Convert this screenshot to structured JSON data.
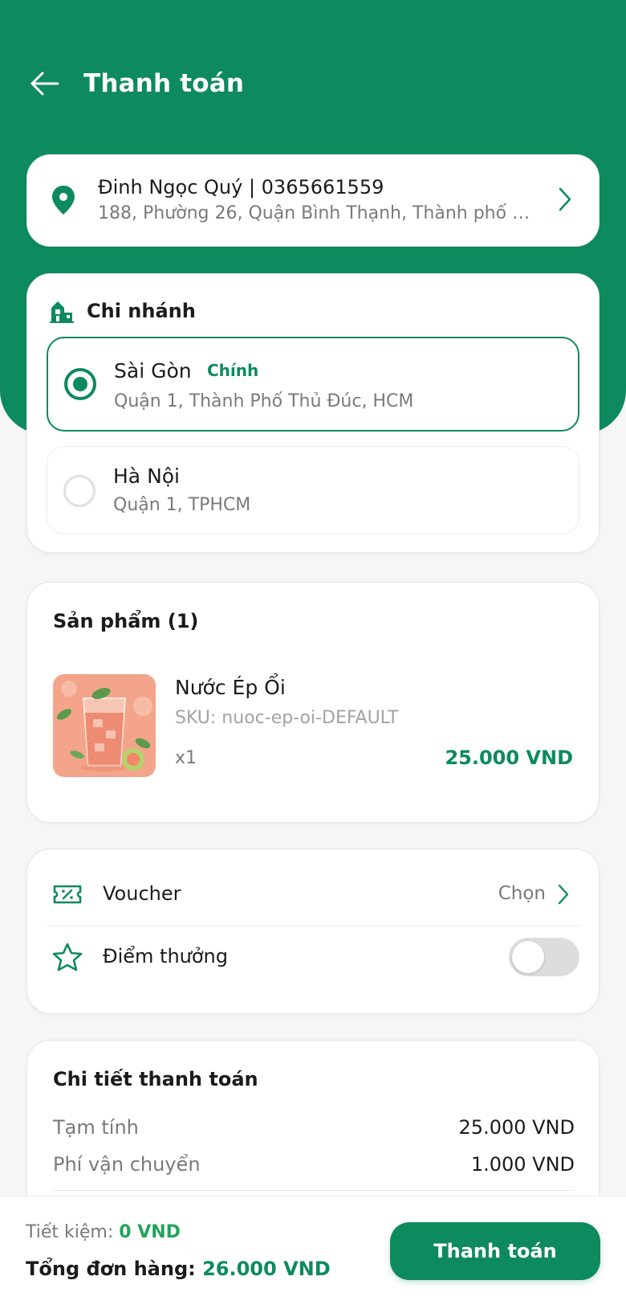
{
  "header": {
    "title": "Thanh toán"
  },
  "address": {
    "name_phone": "Đinh Ngọc Quý | 0365661559",
    "line": "188, Phường 26, Quận Bình Thạnh, Thành phố …"
  },
  "branch": {
    "title": "Chi nhánh",
    "options": [
      {
        "name": "Sài Gòn",
        "tag": "Chính",
        "address": "Quận 1, Thành Phố Thủ Đúc, HCM",
        "selected": true
      },
      {
        "name": "Hà Nội",
        "tag": "",
        "address": "Quận 1, TPHCM",
        "selected": false
      }
    ]
  },
  "products": {
    "title": "Sản phẩm (1)",
    "items": [
      {
        "name": "Nước Ép Ổi",
        "sku": "SKU: nuoc-ep-oi-DEFAULT",
        "qty": "x1",
        "price": "25.000 VND"
      }
    ]
  },
  "options": {
    "voucher_label": "Voucher",
    "voucher_action": "Chọn",
    "points_label": "Điểm thưởng",
    "points_enabled": false
  },
  "payment": {
    "title": "Chi tiết thanh toán",
    "rows": [
      {
        "label": "Tạm tính",
        "value": "25.000 VND"
      },
      {
        "label": "Phí vận chuyển",
        "value": "1.000 VND"
      }
    ]
  },
  "footer": {
    "save_label": "Tiết kiệm:",
    "save_value": "0 VND",
    "total_label": "Tổng đơn hàng:",
    "total_value": "26.000 VND",
    "pay_button": "Thanh toán"
  },
  "colors": {
    "primary": "#0e8a5f",
    "savings": "#22a35a",
    "background": "#f5f6f5"
  }
}
